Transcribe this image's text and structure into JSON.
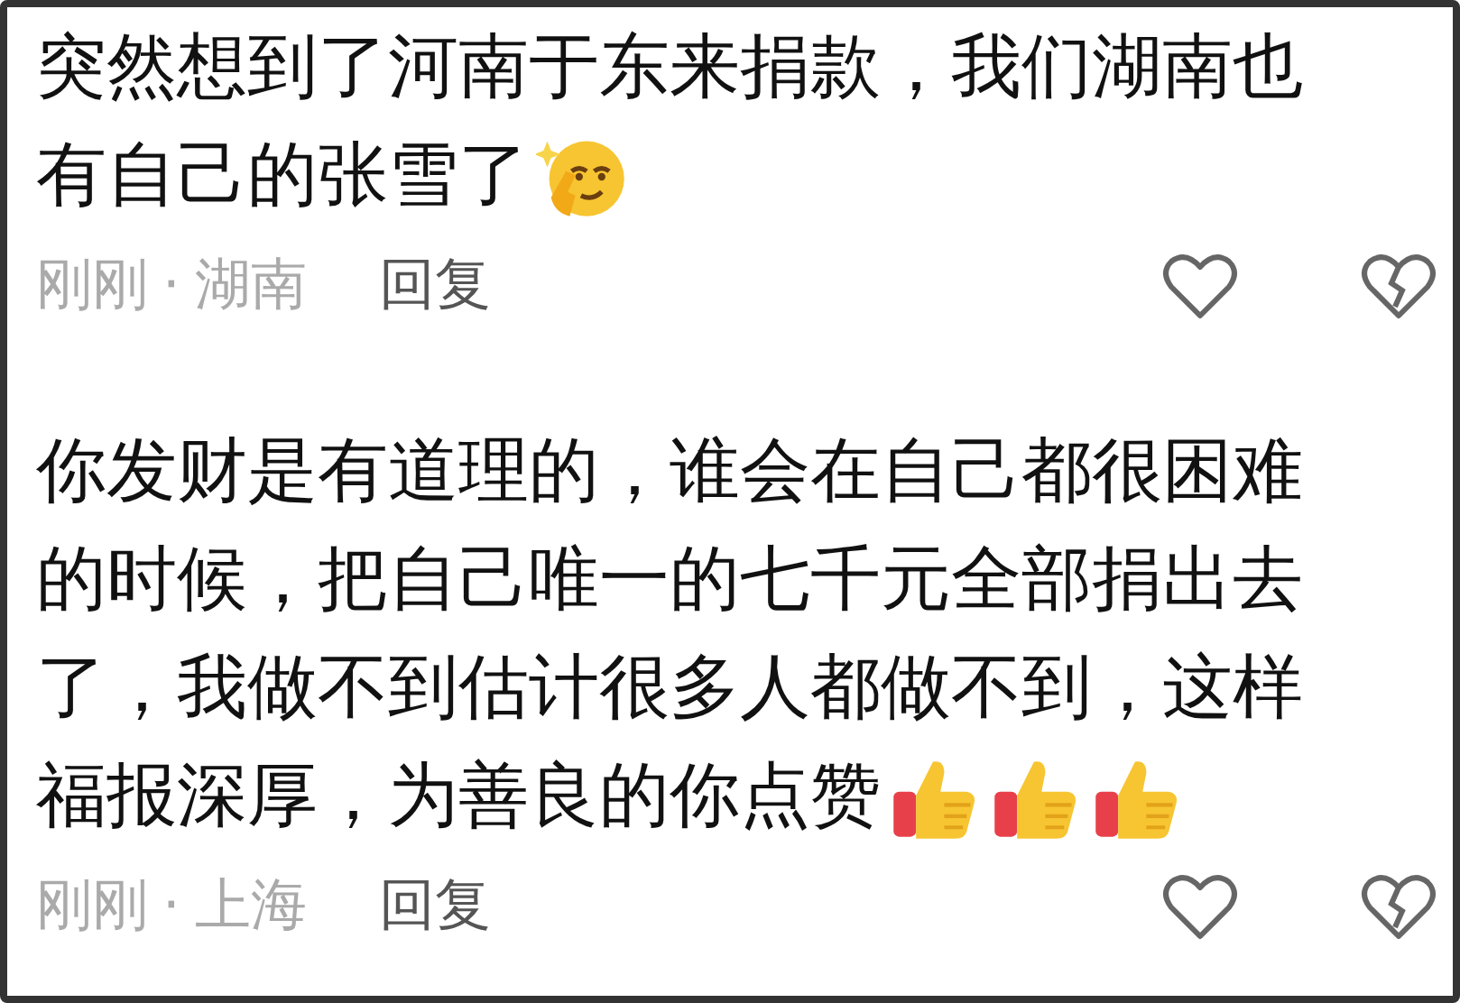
{
  "comments": [
    {
      "lines": [
        "突然想到了河南于东来捐款，我们湖南也",
        "有自己的张雪了"
      ],
      "emojis": [
        {
          "kind": "thinking"
        }
      ],
      "time": "刚刚",
      "separator": "·",
      "location": "湖南",
      "reply": "回复"
    },
    {
      "lines": [
        "你发财是有道理的，谁会在自己都很困难",
        "的时候，把自己唯一的七千元全部捐出去",
        "了，我做不到估计很多人都做不到，这样",
        "福报深厚，为善良的你点赞"
      ],
      "emojis": [
        {
          "kind": "thumbs_up"
        },
        {
          "kind": "thumbs_up"
        },
        {
          "kind": "thumbs_up"
        }
      ],
      "time": "刚刚",
      "separator": "·",
      "location": "上海",
      "reply": "回复"
    }
  ]
}
